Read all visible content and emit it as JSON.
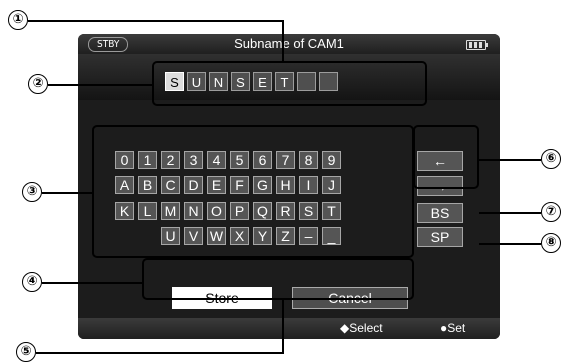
{
  "screen": {
    "status": "STBY",
    "title": "Subname of CAM1",
    "name_chars": [
      "S",
      "U",
      "N",
      "S",
      "E",
      "T",
      "",
      ""
    ],
    "keyboard_rows": [
      [
        "0",
        "1",
        "2",
        "3",
        "4",
        "5",
        "6",
        "7",
        "8",
        "9"
      ],
      [
        "A",
        "B",
        "C",
        "D",
        "E",
        "F",
        "G",
        "H",
        "I",
        "J"
      ],
      [
        "K",
        "L",
        "M",
        "N",
        "O",
        "P",
        "Q",
        "R",
        "S",
        "T"
      ],
      [
        "U",
        "V",
        "W",
        "X",
        "Y",
        "Z",
        "–",
        "_"
      ]
    ],
    "cursor_left": "←",
    "cursor_right": "→",
    "backspace": "BS",
    "space": "SP",
    "store": "Store",
    "cancel": "Cancel",
    "guide_select": "◆Select",
    "guide_set": "●Set"
  },
  "callouts": [
    "①",
    "②",
    "③",
    "④",
    "⑤",
    "⑥",
    "⑦",
    "⑧"
  ]
}
